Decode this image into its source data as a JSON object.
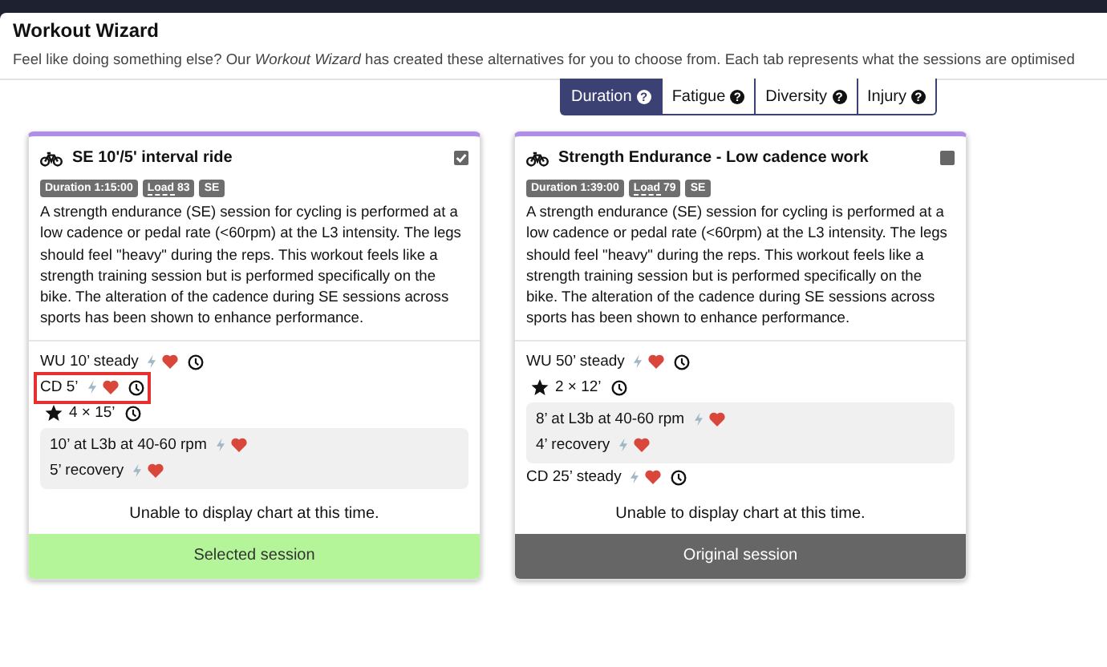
{
  "dialog": {
    "title": "Workout Wizard",
    "subtitle": "Feel like doing something else? Our *Workout Wizard* has created these alternatives for you to choose from. Each tab represents what the sessions are optimised"
  },
  "tabs": [
    {
      "label": "Duration",
      "help": "?",
      "selected": true
    },
    {
      "label": "Fatigue",
      "help": "?",
      "selected": false
    },
    {
      "label": "Diversity",
      "help": "?",
      "selected": false
    },
    {
      "label": "Injury",
      "help": "?",
      "selected": false
    }
  ],
  "cards": [
    {
      "title": "SE 10'/5' interval ride",
      "checked": true,
      "badges": [
        {
          "kind": "plain",
          "text": "Duration 1:15:00"
        },
        {
          "kind": "term",
          "term": "Load",
          "text": "83"
        },
        {
          "kind": "plain",
          "text": "SE"
        }
      ],
      "description": "A strength endurance (SE) session for cycling is performed at a low cadence or pedal rate (<60rpm) at the L3 intensity. The legs should feel \"heavy\" during the reps. This workout feels like a strength training session but is performed specifically on the bike. The alteration of the cadence during SE sessions across sports has been shown to enhance performance.",
      "steps": [
        {
          "kind": "step",
          "text": "WU 10’ steady",
          "power": true,
          "heart": true,
          "duration": true,
          "highlighted": false
        },
        {
          "kind": "step",
          "text": "CD 5’",
          "power": true,
          "heart": true,
          "duration": true,
          "highlighted": true
        },
        {
          "kind": "repeat",
          "text": "4 × 15’",
          "duration": true,
          "highlighted": false,
          "children": [
            {
              "text": "10’ at L3b at 40-60 rpm",
              "power": true,
              "heart": true
            },
            {
              "text": "5’ recovery",
              "power": true,
              "heart": true
            }
          ]
        }
      ],
      "chart_message": "Unable to display chart at this time.",
      "footer": {
        "kind": "selected",
        "label": "Selected session"
      }
    },
    {
      "title": "Strength Endurance - Low cadence work",
      "checked": false,
      "badges": [
        {
          "kind": "plain",
          "text": "Duration 1:39:00"
        },
        {
          "kind": "term",
          "term": "Load",
          "text": "79"
        },
        {
          "kind": "plain",
          "text": "SE"
        }
      ],
      "description": "A strength endurance (SE) session for cycling is performed at a low cadence or pedal rate (<60rpm) at the L3 intensity. The legs should feel \"heavy\" during the reps. This workout feels like a strength training session but is performed specifically on the bike. The alteration of the cadence during SE sessions across sports has been shown to enhance performance.",
      "steps": [
        {
          "kind": "step",
          "text": "WU 50’ steady",
          "power": true,
          "heart": true,
          "duration": true,
          "highlighted": false
        },
        {
          "kind": "repeat",
          "text": "2 × 12’",
          "duration": true,
          "highlighted": false,
          "children": [
            {
              "text": "8’ at L3b at 40-60 rpm",
              "power": true,
              "heart": true
            },
            {
              "text": "4’ recovery",
              "power": true,
              "heart": true
            }
          ]
        },
        {
          "kind": "step",
          "text": "CD 25’ steady",
          "power": true,
          "heart": true,
          "duration": true,
          "highlighted": false
        }
      ],
      "chart_message": "Unable to display chart at this time.",
      "footer": {
        "kind": "original",
        "label": "Original session"
      }
    }
  ]
}
